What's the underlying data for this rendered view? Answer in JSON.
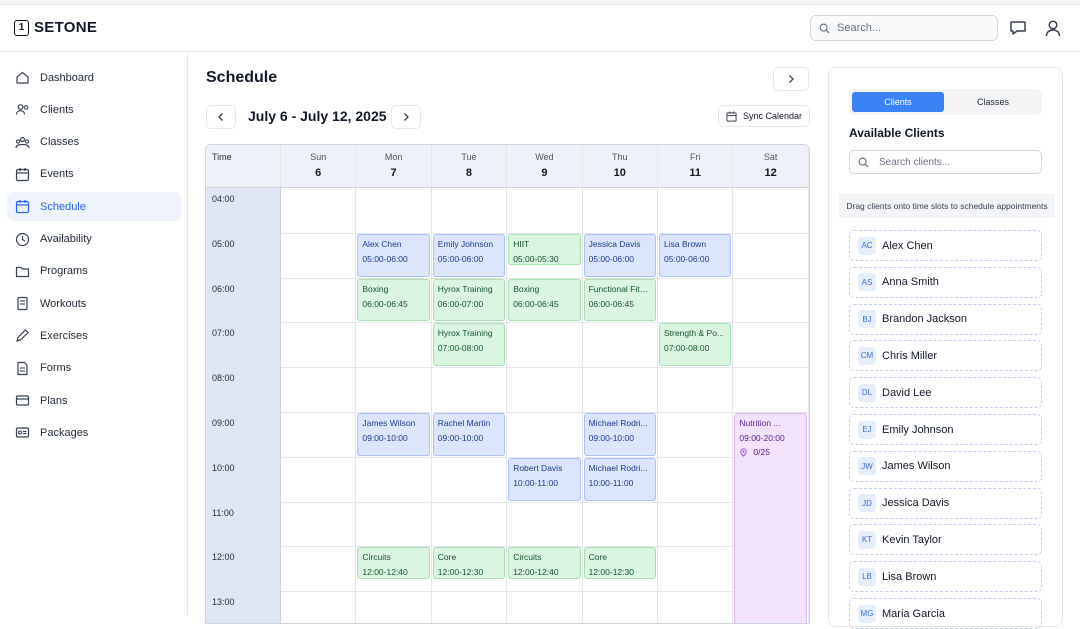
{
  "app": {
    "logo_digit": "1",
    "logo_text": "SETONE"
  },
  "header": {
    "search_placeholder": "Search...",
    "icons": [
      "search-icon",
      "chat-icon",
      "user-icon"
    ]
  },
  "sidebar": {
    "items": [
      {
        "label": "Dashboard",
        "icon": "home-icon",
        "active": false
      },
      {
        "label": "Clients",
        "icon": "users-icon",
        "active": false
      },
      {
        "label": "Classes",
        "icon": "group-icon",
        "active": false
      },
      {
        "label": "Events",
        "icon": "calendar-icon",
        "active": false
      },
      {
        "label": "Schedule",
        "icon": "calendar-icon",
        "active": true
      },
      {
        "label": "Availability",
        "icon": "clock-icon",
        "active": false
      },
      {
        "label": "Programs",
        "icon": "folder-icon",
        "active": false
      },
      {
        "label": "Workouts",
        "icon": "stack-icon",
        "active": false
      },
      {
        "label": "Exercises",
        "icon": "edit-icon",
        "active": false
      },
      {
        "label": "Forms",
        "icon": "document-icon",
        "active": false
      },
      {
        "label": "Plans",
        "icon": "card-icon",
        "active": false
      },
      {
        "label": "Packages",
        "icon": "package-icon",
        "active": false
      }
    ]
  },
  "schedule": {
    "title": "Schedule",
    "date_range": "July 6 - July 12, 2025",
    "sync_label": "Sync Calendar",
    "time_header": "Time",
    "days": [
      {
        "name": "Sun",
        "date": "6"
      },
      {
        "name": "Mon",
        "date": "7"
      },
      {
        "name": "Tue",
        "date": "8"
      },
      {
        "name": "Wed",
        "date": "9"
      },
      {
        "name": "Thu",
        "date": "10"
      },
      {
        "name": "Fri",
        "date": "11"
      },
      {
        "name": "Sat",
        "date": "12"
      }
    ],
    "hours": [
      "04:00",
      "05:00",
      "06:00",
      "07:00",
      "08:00",
      "09:00",
      "10:00",
      "11:00",
      "12:00",
      "13:00"
    ],
    "events": [
      {
        "day": 1,
        "start": 5,
        "end": 6,
        "kind": "client",
        "title": "Alex Chen",
        "time": "05:00-06:00"
      },
      {
        "day": 2,
        "start": 5,
        "end": 6,
        "kind": "client",
        "title": "Emily Johnson",
        "time": "05:00-06:00"
      },
      {
        "day": 3,
        "start": 5,
        "end": 5.75,
        "kind": "class",
        "title": "HIIT",
        "time": "05:00-05:30"
      },
      {
        "day": 4,
        "start": 5,
        "end": 6,
        "kind": "client",
        "title": "Jessica Davis",
        "time": "05:00-06:00"
      },
      {
        "day": 5,
        "start": 5,
        "end": 6,
        "kind": "client",
        "title": "Lisa Brown",
        "time": "05:00-06:00"
      },
      {
        "day": 1,
        "start": 6,
        "end": 7,
        "kind": "class",
        "title": "Boxing",
        "time": "06:00-06:45"
      },
      {
        "day": 2,
        "start": 6,
        "end": 7,
        "kind": "class",
        "title": "Hyrox Training",
        "time": "06:00-07:00"
      },
      {
        "day": 3,
        "start": 6,
        "end": 7,
        "kind": "class",
        "title": "Boxing",
        "time": "06:00-06:45"
      },
      {
        "day": 4,
        "start": 6,
        "end": 7,
        "kind": "class",
        "title": "Functional Fitn...",
        "time": "06:00-06:45"
      },
      {
        "day": 2,
        "start": 7,
        "end": 8,
        "kind": "class",
        "title": "Hyrox Training",
        "time": "07:00-08:00"
      },
      {
        "day": 5,
        "start": 7,
        "end": 8,
        "kind": "class",
        "title": "Strength & Po...",
        "time": "07:00-08:00"
      },
      {
        "day": 1,
        "start": 9,
        "end": 10,
        "kind": "client",
        "title": "James Wilson",
        "time": "09:00-10:00"
      },
      {
        "day": 2,
        "start": 9,
        "end": 10,
        "kind": "client",
        "title": "Rachel Martin",
        "time": "09:00-10:00"
      },
      {
        "day": 4,
        "start": 9,
        "end": 10,
        "kind": "client",
        "title": "Michael Rodri...",
        "time": "09:00-10:00"
      },
      {
        "day": 6,
        "start": 9,
        "end": 20,
        "kind": "event",
        "title": "Nutrition ...",
        "time": "09:00-20:00",
        "capacity": "0/25"
      },
      {
        "day": 3,
        "start": 10,
        "end": 11,
        "kind": "client",
        "title": "Robert Davis",
        "time": "10:00-11:00"
      },
      {
        "day": 4,
        "start": 10,
        "end": 11,
        "kind": "client",
        "title": "Michael Rodri...",
        "time": "10:00-11:00"
      },
      {
        "day": 1,
        "start": 12,
        "end": 12.75,
        "kind": "class",
        "title": "Circuits",
        "time": "12:00-12:40"
      },
      {
        "day": 2,
        "start": 12,
        "end": 12.75,
        "kind": "class",
        "title": "Core",
        "time": "12:00-12:30"
      },
      {
        "day": 3,
        "start": 12,
        "end": 12.75,
        "kind": "class",
        "title": "Circuits",
        "time": "12:00-12:40"
      },
      {
        "day": 4,
        "start": 12,
        "end": 12.75,
        "kind": "class",
        "title": "Core",
        "time": "12:00-12:30"
      }
    ]
  },
  "panel": {
    "tabs": [
      {
        "label": "Clients",
        "active": true
      },
      {
        "label": "Classes",
        "active": false
      }
    ],
    "title": "Available Clients",
    "search_placeholder": "Search clients...",
    "hint": "Drag clients onto time slots to schedule appointments",
    "clients": [
      {
        "initials": "AC",
        "name": "Alex Chen"
      },
      {
        "initials": "AS",
        "name": "Anna Smith"
      },
      {
        "initials": "BJ",
        "name": "Brandon Jackson"
      },
      {
        "initials": "CM",
        "name": "Chris Miller"
      },
      {
        "initials": "DL",
        "name": "David Lee"
      },
      {
        "initials": "EJ",
        "name": "Emily Johnson"
      },
      {
        "initials": "JW",
        "name": "James Wilson"
      },
      {
        "initials": "JD",
        "name": "Jessica Davis"
      },
      {
        "initials": "KT",
        "name": "Kevin Taylor"
      },
      {
        "initials": "LB",
        "name": "Lisa Brown"
      },
      {
        "initials": "MG",
        "name": "Maria Garcia"
      }
    ]
  },
  "colors": {
    "accent": "#3b82f6",
    "client_event": "#dbe6fc",
    "class_event": "#daf5e0",
    "special_event": "#f3e2fb"
  }
}
